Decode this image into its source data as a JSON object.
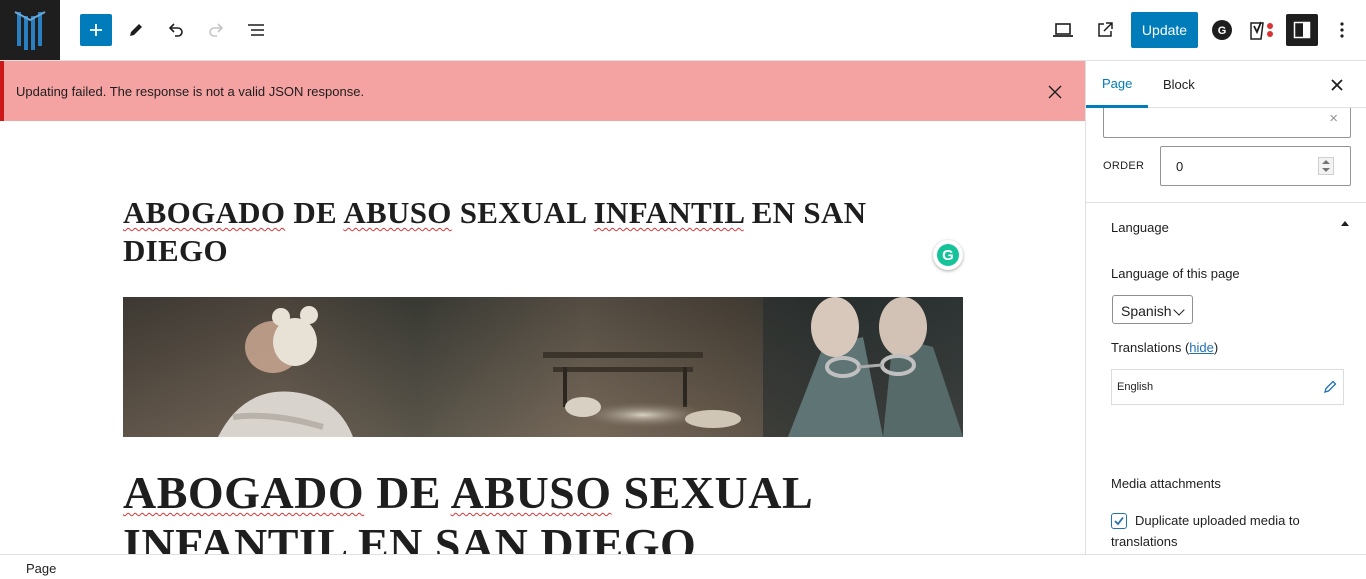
{
  "toolbar": {
    "add_block_icon": "plus-icon",
    "tools_icon": "pencil-icon",
    "undo_icon": "undo-icon",
    "redo_icon": "redo-icon",
    "list_view_icon": "list-view-icon",
    "preview_icon": "laptop-icon",
    "view_post_icon": "external-link-icon",
    "update_label": "Update",
    "accent_color": "#007cba"
  },
  "notice": {
    "message": "Updating failed. The response is not a valid JSON response.",
    "background": "#f4a2a2"
  },
  "editor": {
    "title": "ABOGADO DE ABUSO SEXUAL INFANTIL EN SAN DIEGO",
    "heading_line1_words": [
      "ABOGADO",
      "DE",
      "ABUSO",
      "SEXUAL"
    ],
    "heading_line2": "INFANTIL EN SAN DIEGO",
    "grammarly_letter": "G"
  },
  "sidebar": {
    "tabs": [
      {
        "label": "Page",
        "active": true
      },
      {
        "label": "Block",
        "active": false
      }
    ],
    "order_label": "ORDER",
    "order_value": "0",
    "language_section": "Language",
    "language_of_page_label": "Language of this page",
    "language_selected": "Spanish",
    "translations_label": "Translations",
    "translations_hide": "hide",
    "translation_language": "English",
    "media_section": "Media attachments",
    "duplicate_media_label": "Duplicate uploaded media to translations",
    "duplicate_media_checked": true
  },
  "footer": {
    "breadcrumb": "Page"
  }
}
